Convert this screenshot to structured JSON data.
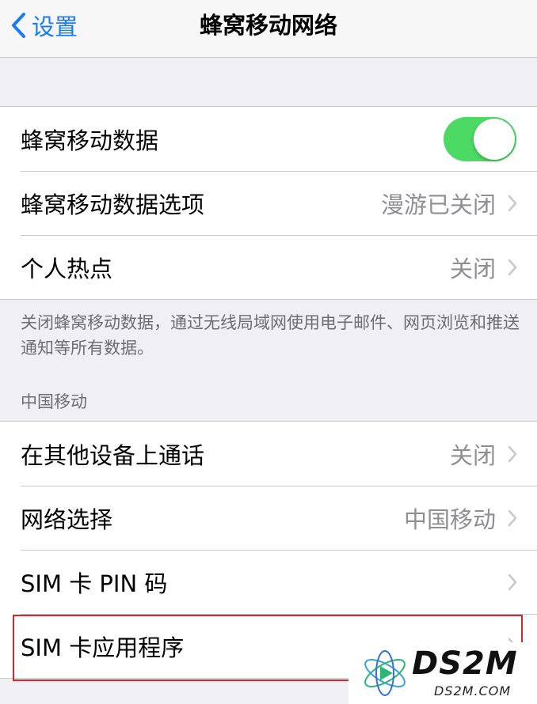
{
  "nav": {
    "back_label": "设置",
    "title": "蜂窝移动网络"
  },
  "group1": {
    "rows": [
      {
        "label": "蜂窝移动数据",
        "control": "toggle",
        "toggle_on": true
      },
      {
        "label": "蜂窝移动数据选项",
        "value": "漫游已关闭"
      },
      {
        "label": "个人热点",
        "value": "关闭"
      }
    ],
    "footer": "关闭蜂窝移动数据，通过无线局域网使用电子邮件、网页浏览和推送通知等所有数据。"
  },
  "group2": {
    "header": "中国移动",
    "rows": [
      {
        "label": "在其他设备上通话",
        "value": "关闭"
      },
      {
        "label": "网络选择",
        "value": "中国移动"
      },
      {
        "label": "SIM 卡 PIN 码",
        "value": ""
      },
      {
        "label": "SIM 卡应用程序",
        "value": ""
      }
    ]
  },
  "watermark": {
    "brand": "DS2M",
    "url": "DS2M.COM"
  },
  "colors": {
    "accent_blue": "#1a7cf5",
    "toggle_green": "#4cd964",
    "highlight_red": "#d9262c",
    "background": "#efeff4"
  }
}
